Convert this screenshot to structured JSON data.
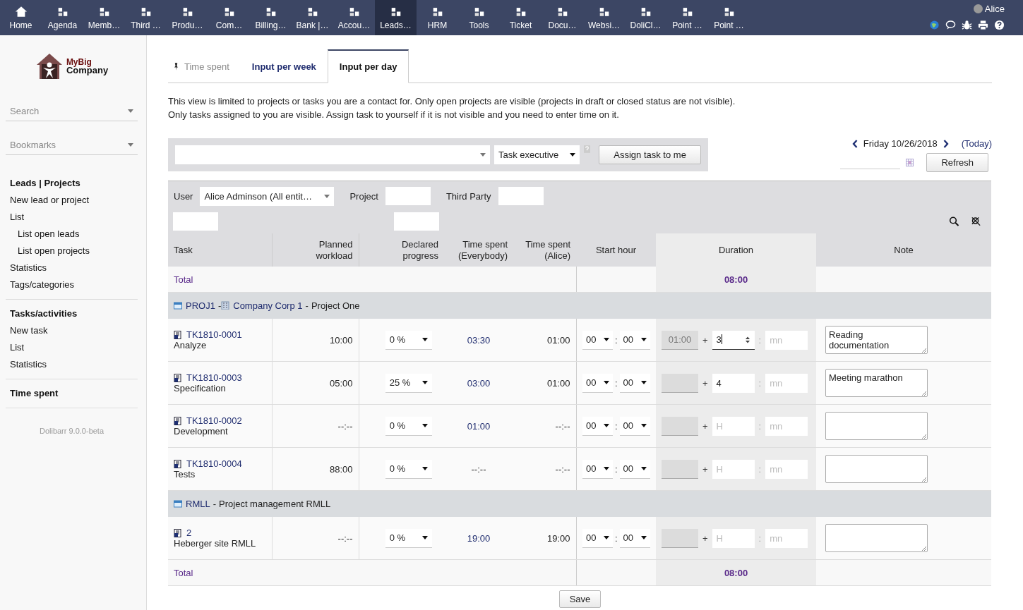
{
  "top_menu": [
    {
      "label": "Home",
      "selected": false
    },
    {
      "label": "Agenda",
      "selected": false
    },
    {
      "label": "Memb…",
      "selected": false
    },
    {
      "label": "Third …",
      "selected": false
    },
    {
      "label": "Produ…",
      "selected": false
    },
    {
      "label": "Com…",
      "selected": false
    },
    {
      "label": "Billing…",
      "selected": false
    },
    {
      "label": "Bank |…",
      "selected": false
    },
    {
      "label": "Accou…",
      "selected": false
    },
    {
      "label": "Leads…",
      "selected": true
    },
    {
      "label": "HRM",
      "selected": false
    },
    {
      "label": "Tools",
      "selected": false
    },
    {
      "label": "Ticket",
      "selected": false
    },
    {
      "label": "Docu…",
      "selected": false
    },
    {
      "label": "Websi…",
      "selected": false
    },
    {
      "label": "DoliCl…",
      "selected": false
    },
    {
      "label": "Point …",
      "selected": false
    },
    {
      "label": "Point …",
      "selected": false
    }
  ],
  "user": {
    "name": "Alice"
  },
  "logo": {
    "line1": "MyBig",
    "line2": "Company"
  },
  "sidebar": {
    "search": {
      "placeholder": "Search"
    },
    "bookmarks": {
      "placeholder": "Bookmarks"
    },
    "sections": [
      {
        "title": "Leads | Projects",
        "items": [
          {
            "label": "New lead or project"
          },
          {
            "label": "List",
            "children": [
              {
                "label": "List open leads"
              },
              {
                "label": "List open projects"
              }
            ]
          },
          {
            "label": "Statistics"
          },
          {
            "label": "Tags/categories"
          }
        ]
      },
      {
        "title": "Tasks/activities",
        "items": [
          {
            "label": "New task"
          },
          {
            "label": "List"
          },
          {
            "label": "Statistics"
          }
        ]
      },
      {
        "title": "Time spent"
      }
    ],
    "version": "Dolibarr 9.0.0-beta"
  },
  "tabs": [
    {
      "label": "Time spent",
      "kind": "pinned",
      "selected": false
    },
    {
      "label": "Input per week",
      "kind": "normal",
      "selected": false
    },
    {
      "label": "Input per day",
      "kind": "normal",
      "selected": true
    }
  ],
  "info_lines": [
    "This view is limited to projects or tasks you are a contact for. Only open projects are visible (projects in draft or closed status are not visible).",
    "Only tasks assigned to you are visible. Assign task to yourself if it is not visible and you need to enter time on it."
  ],
  "assign": {
    "role": "Task executive",
    "button": "Assign task to me"
  },
  "date_nav": {
    "date": "Friday 10/26/2018",
    "today": "(Today)",
    "refresh": "Refresh"
  },
  "filters": {
    "user_label": "User",
    "user_value": "Alice Adminson (All entit…",
    "project_label": "Project",
    "thirdparty_label": "Third Party"
  },
  "columns": [
    "Task",
    "Planned workload",
    "Declared progress",
    "Time spent (Everybody)",
    "Time spent (Alice)",
    "Start hour",
    "Duration",
    "Note"
  ],
  "total_top": {
    "label": "Total",
    "duration": "08:00"
  },
  "rows": [
    {
      "kind": "project",
      "ref": "PROJ1",
      "sep1": "-",
      "thirdparty": "Company Corp 1",
      "sep2": "-",
      "title": "Project One"
    },
    {
      "kind": "task",
      "ref": "TK1810-0001",
      "label": "Analyze",
      "planned": "10:00",
      "progress": "0 %",
      "spent_all": "03:30",
      "spent_all_link": true,
      "spent_user": "01:00",
      "start_h": "00",
      "start_sep": ":",
      "start_m": "00",
      "existing": "01:00",
      "plus": "+",
      "hours": "3",
      "focused": true,
      "dur_sep": ":",
      "mn_placeholder": "mn",
      "note": "Reading documentation"
    },
    {
      "kind": "task",
      "ref": "TK1810-0003",
      "label": "Specification",
      "planned": "05:00",
      "progress": "25 %",
      "spent_all": "03:00",
      "spent_all_link": true,
      "spent_user": "01:00",
      "start_h": "00",
      "start_sep": ":",
      "start_m": "00",
      "plus": "+",
      "hours": "4",
      "focused": false,
      "dur_sep": ":",
      "mn_placeholder": "mn",
      "note": "Meeting marathon"
    },
    {
      "kind": "task",
      "ref": "TK1810-0002",
      "label": "Development",
      "planned": "--:--",
      "progress": "0 %",
      "spent_all": "01:00",
      "spent_all_link": true,
      "spent_user": "--:--",
      "start_h": "00",
      "start_sep": ":",
      "start_m": "00",
      "plus": "+",
      "hours_placeholder": "H",
      "focused": false,
      "dur_sep": ":",
      "mn_placeholder": "mn"
    },
    {
      "kind": "task",
      "ref": "TK1810-0004",
      "label": "Tests",
      "planned": "88:00",
      "progress": "0 %",
      "spent_all": "--:--",
      "spent_all_link": false,
      "spent_user": "--:--",
      "start_h": "00",
      "start_sep": ":",
      "start_m": "00",
      "plus": "+",
      "hours_placeholder": "H",
      "focused": false,
      "dur_sep": ":",
      "mn_placeholder": "mn"
    },
    {
      "kind": "project",
      "ref": "RMLL",
      "sep1": "-",
      "title": "Project management RMLL"
    },
    {
      "kind": "task",
      "ref": "2",
      "label": "Heberger site RMLL",
      "planned": "--:--",
      "progress": "0 %",
      "spent_all": "19:00",
      "spent_all_link": true,
      "spent_user": "19:00",
      "start_h": "00",
      "start_sep": ":",
      "start_m": "00",
      "plus": "+",
      "hours_placeholder": "H",
      "focused": false,
      "dur_sep": ":",
      "mn_placeholder": "mn"
    }
  ],
  "total_bottom": {
    "label": "Total",
    "duration": "08:00"
  },
  "save": "Save"
}
